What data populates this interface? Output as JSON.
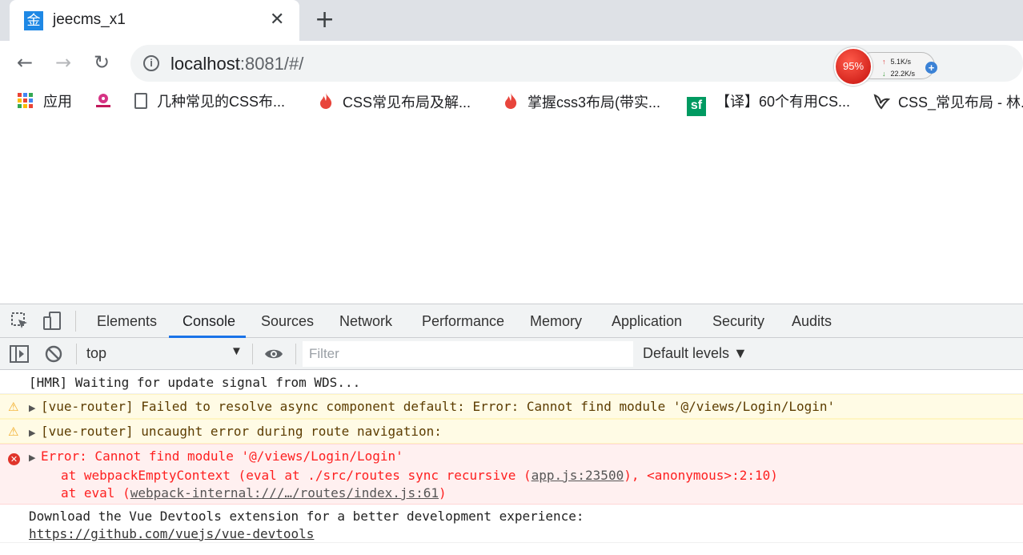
{
  "browser": {
    "tab": {
      "favicon_char": "金",
      "title": "jeecms_x1",
      "close": "✕"
    },
    "new_tab": "+",
    "nav": {
      "back": "←",
      "forward": "→",
      "reload": "↻"
    },
    "address": {
      "info": "i",
      "host": "localhost",
      "rest": ":8081/#/"
    },
    "speed_widget": {
      "percent": "95%",
      "upload": "5.1K/s",
      "download": "22.2K/s",
      "plus": "+"
    },
    "bookmarks": [
      {
        "label": "应用",
        "icon": "apps-grid-icon"
      },
      {
        "label": "",
        "icon": "flower-logo-icon"
      },
      {
        "label": "几种常见的CSS布...",
        "icon": "document-icon"
      },
      {
        "label": "CSS常见布局及解...",
        "icon": "flame-icon"
      },
      {
        "label": "掌握css3布局(带实...",
        "icon": "flame-icon"
      },
      {
        "label": "【译】60个有用CS...",
        "icon": "sf-icon"
      },
      {
        "label": "CSS_常见布局 - 林.",
        "icon": "bird-icon"
      }
    ]
  },
  "devtools": {
    "tabs": [
      "Elements",
      "Console",
      "Sources",
      "Network",
      "Performance",
      "Memory",
      "Application",
      "Security",
      "Audits"
    ],
    "active_tab": "Console",
    "context": "top",
    "filter_placeholder": "Filter",
    "levels": "Default levels ▼",
    "messages": [
      {
        "level": "log",
        "lines": [
          "[HMR] Waiting for update signal from WDS..."
        ]
      },
      {
        "level": "warn",
        "lines": [
          "[vue-router] Failed to resolve async component default: Error: Cannot find module '@/views/Login/Login'"
        ]
      },
      {
        "level": "warn",
        "lines": [
          "[vue-router] uncaught error during route navigation:"
        ]
      },
      {
        "level": "error",
        "lines": [
          "Error: Cannot find module '@/views/Login/Login'",
          "at webpackEmptyContext (eval at ./src/routes sync recursive (",
          "app.js:23500",
          "), <anonymous>:2:10)",
          "at eval (",
          "webpack-internal:///…/routes/index.js:61",
          ")"
        ]
      },
      {
        "level": "log",
        "lines": [
          "Download the Vue Devtools extension for a better development experience:",
          "https://github.com/vuejs/vue-devtools"
        ]
      }
    ]
  }
}
